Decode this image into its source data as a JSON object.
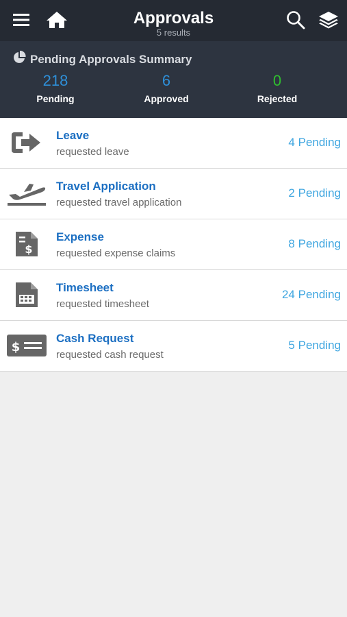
{
  "header": {
    "title": "Approvals",
    "subtitle": "5 results",
    "icons": [
      "menu-icon",
      "home-icon",
      "search-icon",
      "layers-icon"
    ]
  },
  "summary": {
    "title": "Pending Approvals Summary",
    "stats": {
      "pending": {
        "value": "218",
        "label": "Pending"
      },
      "approved": {
        "value": "6",
        "label": "Approved"
      },
      "rejected": {
        "value": "0",
        "label": "Rejected"
      }
    }
  },
  "items": [
    {
      "title": "Leave",
      "subtitle": "requested leave",
      "count": "4 Pending",
      "icon": "sign-out-icon"
    },
    {
      "title": "Travel Application",
      "subtitle": "requested travel application",
      "count": "2 Pending",
      "icon": "plane-icon"
    },
    {
      "title": "Expense",
      "subtitle": "requested expense claims",
      "count": "8 Pending",
      "icon": "dollar-document-icon"
    },
    {
      "title": "Timesheet",
      "subtitle": "requested timesheet",
      "count": "24 Pending",
      "icon": "calendar-document-icon"
    },
    {
      "title": "Cash Request",
      "subtitle": "requested cash request",
      "count": "5 Pending",
      "icon": "cash-card-icon"
    }
  ],
  "colors": {
    "header_bg": "#252a33",
    "summary_bg": "#2d3440",
    "link_blue": "#1c6fc2",
    "pending_blue": "#3fa6e0",
    "rejected_green": "#2fbf2f"
  }
}
